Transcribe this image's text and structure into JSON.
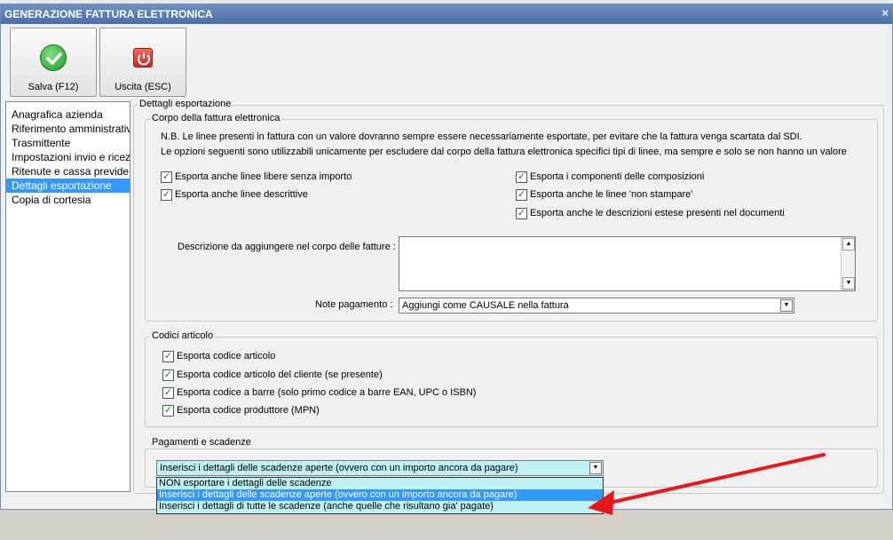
{
  "window": {
    "title": "GENERAZIONE FATTURA ELETTRONICA",
    "close_label": "×"
  },
  "toolbar": {
    "save_label": "Salva (F12)",
    "exit_label": "Uscita (ESC)",
    "exit_icon_glyph": "⏻"
  },
  "sidebar": {
    "items": [
      {
        "label": "Anagrafica azienda"
      },
      {
        "label": "Riferimento amministrativo"
      },
      {
        "label": "Trasmittente"
      },
      {
        "label": "Impostazioni invio e ricezione"
      },
      {
        "label": "Ritenute e cassa previdenziale"
      },
      {
        "label": "Dettagli esportazione",
        "selected": true
      },
      {
        "label": "Copia di cortesia"
      }
    ]
  },
  "details": {
    "title": "Dettagli esportazione",
    "body": {
      "title": "Corpo della fattura elettronica",
      "note1": "N.B. Le linee presenti in fattura con un valore dovranno sempre essere necessariamente esportate, per evitare che la fattura venga scartata dal SDI.",
      "note2": "Le opzioni seguenti sono utilizzabili unicamente per escludere dal corpo della fattura elettronica specifici tipi di linee, ma sempre e solo se non hanno un valore",
      "checkboxes": [
        {
          "label": "Esporta anche linee libere senza importo",
          "checked": true
        },
        {
          "label": "Esporta anche linee descrittive",
          "checked": true
        },
        {
          "label": "Esporta i componenti delle composizioni",
          "checked": true
        },
        {
          "label": "Esporta anche le linee 'non stampare'",
          "checked": true
        },
        {
          "label": "Esporta anche le descrizioni estese presenti nel documenti",
          "checked": true
        }
      ],
      "description_label": "Descrizione da aggiungere nel corpo delle fatture :",
      "description_value": "",
      "payment_notes_label": "Note pagamento :",
      "payment_notes_value": "Aggiungi come CAUSALE nella fattura"
    },
    "codes": {
      "title": "Codici articolo",
      "checkboxes": [
        {
          "label": "Esporta codice articolo",
          "checked": true
        },
        {
          "label": "Esporta codice articolo del cliente (se presente)",
          "checked": true
        },
        {
          "label": "Esporta codice a barre (solo primo codice a barre EAN, UPC o ISBN)",
          "checked": true
        },
        {
          "label": "Esporta codice produttore (MPN)",
          "checked": true
        }
      ]
    },
    "payments": {
      "title": "Pagamenti e scadenze",
      "selected_value": "Inserisci i dettagli delle scadenze aperte (ovvero con un importo ancora da pagare)",
      "options": [
        {
          "label": "NON esportare i dettagli delle scadenze"
        },
        {
          "label": "Inserisci i dettagli delle scadenze aperte (ovvero con un importo ancora da pagare)",
          "highlighted": true
        },
        {
          "label": "Inserisci i dettagli di tutte le scadenze (anche quelle che risultano gia' pagate)"
        }
      ]
    }
  },
  "colors": {
    "title_bar": "#4a6ea8",
    "selection": "#3399ff",
    "dropdown_bg": "#bff0f2",
    "annotation_arrow": "#e81818",
    "check_green": "#1a7a1a"
  }
}
